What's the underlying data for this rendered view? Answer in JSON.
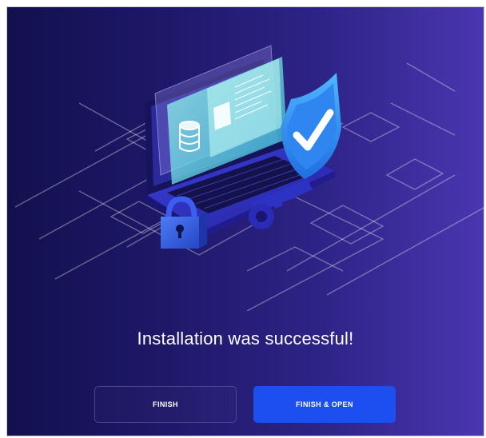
{
  "message": "Installation was successful!",
  "buttons": {
    "finish": "FINISH",
    "finish_open": "FINISH & OPEN"
  },
  "illustration": {
    "icons": [
      "laptop-icon",
      "shield-check-icon",
      "padlock-icon",
      "key-icon",
      "database-icon"
    ]
  },
  "colors": {
    "background_start": "#13104f",
    "background_end": "#4a36b0",
    "primary_button": "#1d4ff0",
    "text": "#ffffff"
  }
}
